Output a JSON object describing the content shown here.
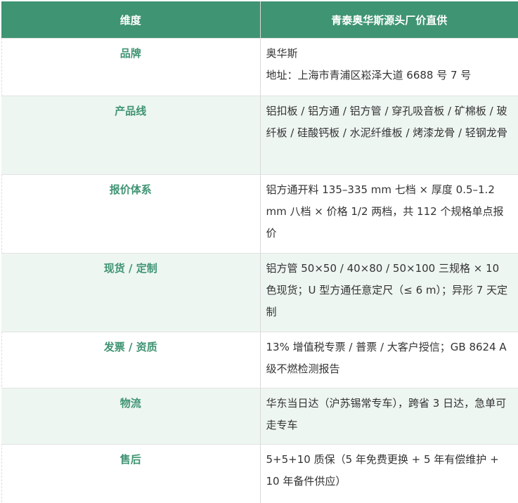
{
  "header": {
    "col1": "维度",
    "col2": "青泰奥华斯源头厂价直供"
  },
  "rows": [
    {
      "dim": "品牌",
      "lines": [
        "奥华斯",
        "地址：上海市青浦区崧泽大道 6688 号 7 号"
      ]
    },
    {
      "dim": "产品线",
      "lines": [
        "铝扣板 / 铝方通 / 铝方管 / 穿孔吸音板 / 矿棉板 / 玻纤板 / 硅酸钙板 / 水泥纤维板 / 烤漆龙骨 / 轻钢龙骨"
      ]
    },
    {
      "dim": "报价体系",
      "lines": [
        "铝方通开料 135–335 mm 七档 × 厚度 0.5–1.2 mm 八档 × 价格 1/2 两档，共 112 个规格单点报价"
      ]
    },
    {
      "dim": "现货 / 定制",
      "lines": [
        "铝方管 50×50 / 40×80 / 50×100 三规格 × 10 色现货；U 型方通任意定尺（≤ 6 m）；异形 7 天定制"
      ]
    },
    {
      "dim": "发票 / 资质",
      "lines": [
        "13% 增值税专票 / 普票 / 大客户授信；GB 8624 A 级不燃检测报告"
      ]
    },
    {
      "dim": "物流",
      "lines": [
        "华东当日达（沪苏锡常专车），跨省 3 日达，急单可走专车"
      ]
    },
    {
      "dim": "售后",
      "lines": [
        "5+5+10 质保（5 年免费更换 + 5 年有偿维护 + 10 年备件供应）"
      ]
    }
  ],
  "colors": {
    "header_bg": "#3f9473",
    "header_text": "#ffffff",
    "dim_text": "#3f9473",
    "alt_row_bg": "#eef6f1",
    "body_text": "#333333"
  }
}
